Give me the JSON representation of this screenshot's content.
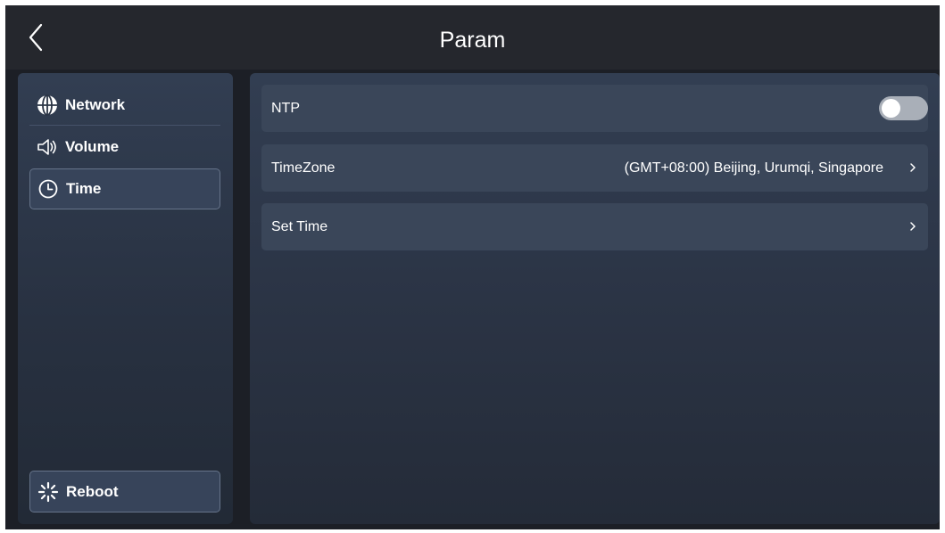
{
  "header": {
    "title": "Param",
    "back_icon": "chevron-left-icon"
  },
  "sidebar": {
    "items": [
      {
        "label": "Network",
        "icon": "globe-icon",
        "active": false
      },
      {
        "label": "Volume",
        "icon": "speaker-icon",
        "active": false
      },
      {
        "label": "Time",
        "icon": "clock-icon",
        "active": true
      }
    ],
    "reboot": {
      "label": "Reboot",
      "icon": "loading-spinner-icon"
    }
  },
  "settings": {
    "ntp": {
      "label": "NTP",
      "enabled": false
    },
    "timezone": {
      "label": "TimeZone",
      "value": "(GMT+08:00) Beijing, Urumqi, Singapore"
    },
    "set_time": {
      "label": "Set Time"
    }
  },
  "colors": {
    "background": "#1c1f26",
    "topbar": "#25272d",
    "panel": "#323e52",
    "row": "#3a4659",
    "toggle_off": "#a9afb8",
    "text": "#ffffff"
  }
}
